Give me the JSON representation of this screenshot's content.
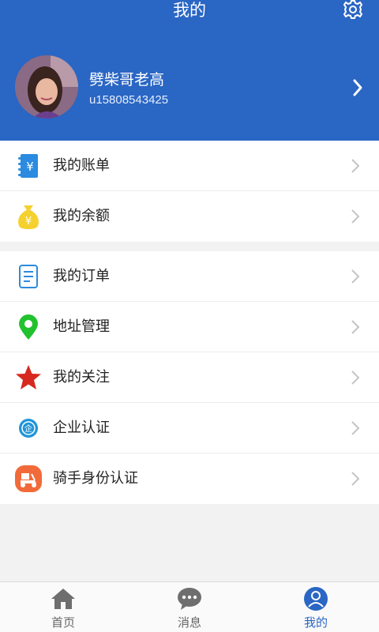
{
  "header": {
    "title": "我的"
  },
  "profile": {
    "name": "劈柴哥老高",
    "account": "u15808543425"
  },
  "group1": [
    {
      "label": "我的账单",
      "icon": "bill-icon"
    },
    {
      "label": "我的余额",
      "icon": "money-bag-icon"
    }
  ],
  "group2": [
    {
      "label": "我的订单",
      "icon": "order-document-icon"
    },
    {
      "label": "地址管理",
      "icon": "location-pin-icon"
    },
    {
      "label": "我的关注",
      "icon": "star-icon"
    },
    {
      "label": "企业认证",
      "icon": "enterprise-icon"
    },
    {
      "label": "骑手身份认证",
      "icon": "rider-scooter-icon"
    }
  ],
  "tabbar": {
    "items": [
      {
        "label": "首页",
        "icon": "home-icon",
        "active": false
      },
      {
        "label": "消息",
        "icon": "chat-bubble-icon",
        "active": false
      },
      {
        "label": "我的",
        "icon": "user-profile-icon",
        "active": true
      }
    ]
  },
  "colors": {
    "primary": "#2a66c4",
    "background": "#f2f2f2",
    "star": "#d6281e",
    "pin": "#22c22e",
    "money": "#f5d130",
    "rider": "#f26a3a"
  }
}
